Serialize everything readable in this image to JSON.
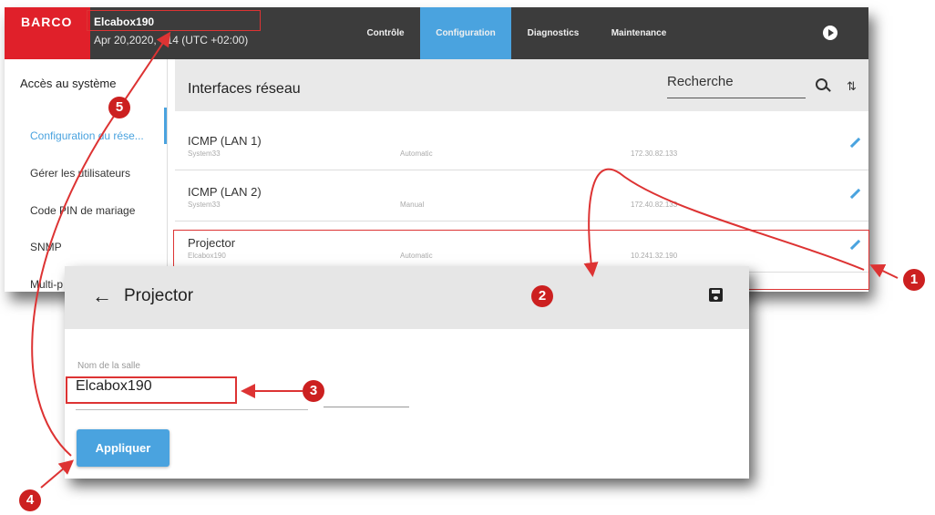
{
  "header": {
    "brand": "BARCO",
    "device_name": "Elcabox190",
    "device_date": "Apr 20,2020, • 14 (UTC +02:00)",
    "tabs": [
      {
        "label": "Contrôle",
        "active": false
      },
      {
        "label": "Configuration",
        "active": true
      },
      {
        "label": "Diagnostics",
        "active": false
      },
      {
        "label": "Maintenance",
        "active": false
      }
    ]
  },
  "sidebar": {
    "heading": "Accès au système",
    "items": [
      {
        "label": "Configuration du rése...",
        "active": true
      },
      {
        "label": "Gérer les utilisateurs",
        "active": false
      },
      {
        "label": "Code PIN de mariage",
        "active": false
      },
      {
        "label": "SNMP",
        "active": false
      },
      {
        "label": "Multi-p",
        "active": false
      }
    ]
  },
  "main": {
    "title": "Interfaces réseau",
    "search_placeholder": "Recherche",
    "rows": [
      {
        "name": "ICMP (LAN 1)",
        "sub": "System33",
        "mode": "Automatic",
        "ip": "172.30.82.133"
      },
      {
        "name": "ICMP (LAN 2)",
        "sub": "System33",
        "mode": "Manual",
        "ip": "172.40.82.133"
      },
      {
        "name": "Projector",
        "sub": "Elcabox190",
        "mode": "Automatic",
        "ip": "10.241.32.190"
      }
    ]
  },
  "dialog": {
    "title": "Projector",
    "field_label": "Nom de la salle",
    "field_value": "Elcabox190",
    "apply_label": "Appliquer"
  },
  "callouts": [
    "1",
    "2",
    "3",
    "4",
    "5"
  ],
  "colors": {
    "accent": "#4aa3df",
    "brand": "#e0202a",
    "topbar": "#3c3c3c",
    "callout": "#cc2020"
  }
}
